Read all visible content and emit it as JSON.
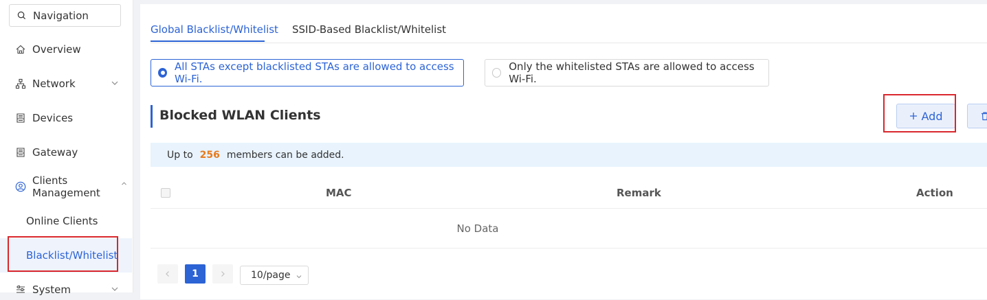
{
  "sidebar": {
    "search_placeholder": "Navigation",
    "items": [
      {
        "label": "Overview",
        "icon": "home-icon"
      },
      {
        "label": "Network",
        "icon": "network-icon"
      },
      {
        "label": "Devices",
        "icon": "devices-icon"
      },
      {
        "label": "Gateway",
        "icon": "gateway-icon"
      },
      {
        "label": "Clients Management",
        "icon": "user-circle-icon"
      },
      {
        "label": "System",
        "icon": "sliders-icon"
      }
    ],
    "sub_items": [
      {
        "label": "Online Clients"
      },
      {
        "label": "Blacklist/Whitelist",
        "active": true
      }
    ]
  },
  "tabs": [
    {
      "label": "Global Blacklist/Whitelist",
      "active": true
    },
    {
      "label": "SSID-Based Blacklist/Whitelist",
      "active": false
    }
  ],
  "mode": {
    "option_blacklist": "All STAs except blacklisted STAs are allowed to access Wi-Fi.",
    "option_whitelist": "Only the whitelisted STAs are allowed to access Wi-Fi.",
    "selected": "blacklist"
  },
  "section": {
    "title": "Blocked WLAN Clients",
    "add_label": "Add"
  },
  "info": {
    "prefix": "Up to",
    "count": "256",
    "suffix": "members can be added."
  },
  "table": {
    "columns": [
      "MAC",
      "Remark",
      "Action"
    ],
    "empty_text": "No Data"
  },
  "pagination": {
    "current_page": "1",
    "page_size": "10/page"
  },
  "colors": {
    "accent": "#2c63d5",
    "highlight_box": "#d9262c",
    "count": "#e87a1c"
  }
}
